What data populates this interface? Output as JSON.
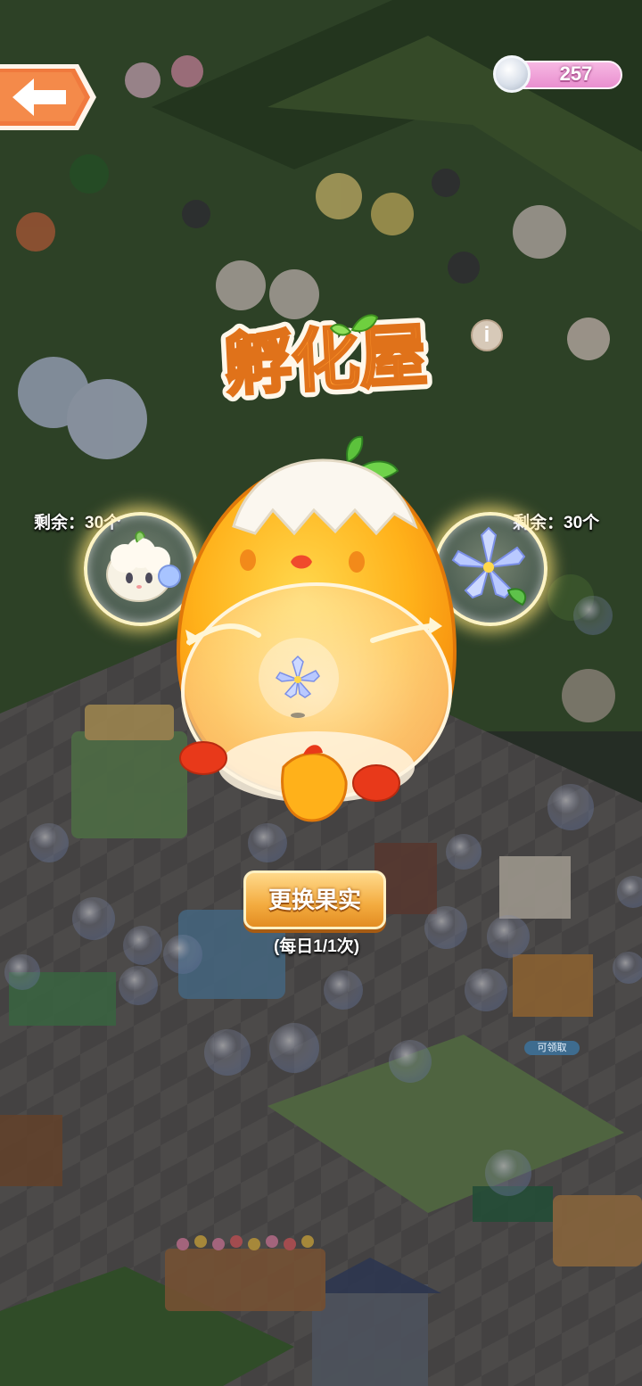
{
  "header": {
    "back_icon": "left-arrow-icon",
    "currency": {
      "icon": "silver-coin-icon",
      "amount": "257"
    }
  },
  "panel": {
    "title": "孵化屋",
    "info_icon_glyph": "i",
    "left_slot": {
      "remaining_text": "剩余：30个",
      "item_icon": "white-cauliflower-creature-icon"
    },
    "right_slot": {
      "remaining_text": "剩余：30个",
      "item_icon": "blue-lily-flower-icon"
    },
    "hatcher_icon": "chick-egg-hatcher-icon",
    "swap_button_label": "更换果实",
    "swap_note": "(每日1/1次)"
  },
  "background": {
    "claim_label": "可领取"
  },
  "colors": {
    "button_orange": "#f3ab3f",
    "title_orange": "#ff9a2e",
    "currency_pink": "#e98fcf",
    "back_button_orange": "#f07a3e"
  }
}
